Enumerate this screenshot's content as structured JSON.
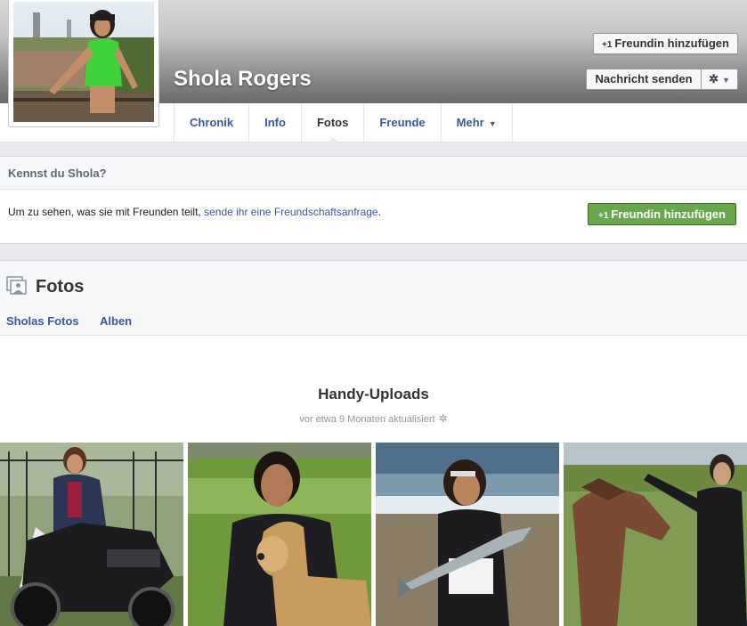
{
  "profile": {
    "name": "Shola Rogers",
    "add_friend_label": "Freundin hinzufügen",
    "add_friend_prefix": "+1",
    "message_label": "Nachricht senden",
    "gear_symbol": "✲"
  },
  "tabs": [
    {
      "label": "Chronik"
    },
    {
      "label": "Info"
    },
    {
      "label": "Fotos"
    },
    {
      "label": "Freunde"
    },
    {
      "label": "Mehr"
    }
  ],
  "know": {
    "title": "Kennst du Shola?",
    "text_before": "Um zu sehen, was sie mit Freunden teilt, ",
    "link": "sende ihr eine Freundschaftsanfrage",
    "text_after": ".",
    "button_label": "Freundin hinzufügen",
    "button_prefix": "+1"
  },
  "photos_section": {
    "title": "Fotos",
    "links": [
      "Sholas Fotos",
      "Alben"
    ],
    "album_title": "Handy-Uploads",
    "album_sub": "vor etwa 9 Monaten aktualisiert",
    "gear_symbol": "✲"
  },
  "colors": {
    "link": "#3b5998",
    "green": "#69a74e"
  }
}
